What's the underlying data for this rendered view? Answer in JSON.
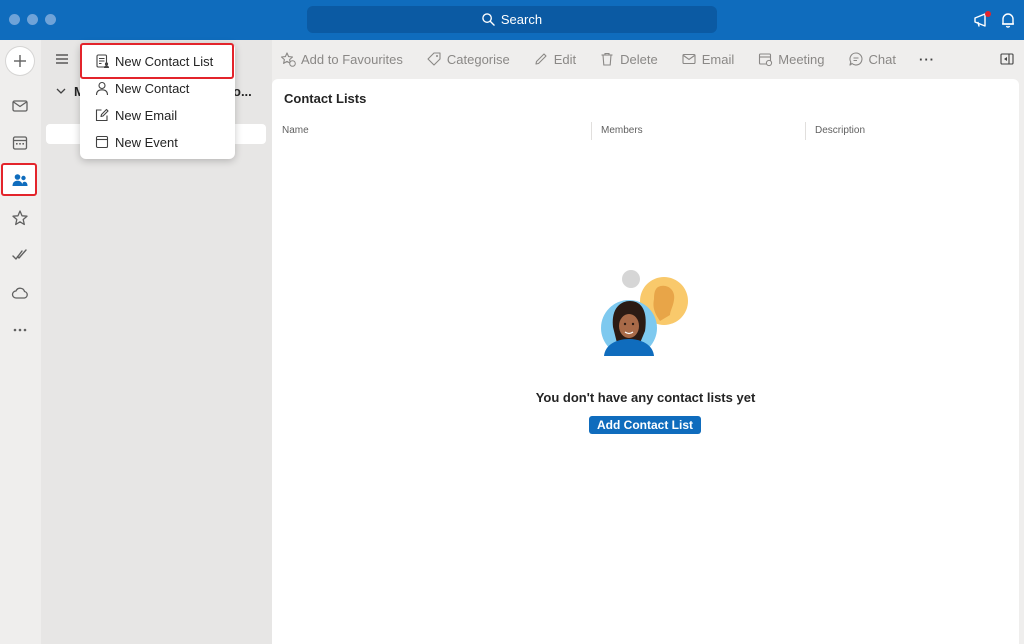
{
  "titlebar": {
    "search_label": "Search",
    "accent_color": "#0f6cbd"
  },
  "rail": {
    "items": [
      {
        "name": "mail-icon"
      },
      {
        "name": "calendar-icon"
      },
      {
        "name": "people-icon",
        "selected": true
      },
      {
        "name": "star-icon"
      },
      {
        "name": "tasks-icon"
      },
      {
        "name": "cloud-icon"
      },
      {
        "name": "more-icon"
      }
    ]
  },
  "folder_pane": {
    "folder_label": "M",
    "folder_more": "o..."
  },
  "new_menu": {
    "items": [
      {
        "label": "New Contact List",
        "icon": "contact-list-icon",
        "highlighted": true
      },
      {
        "label": "New Contact",
        "icon": "person-icon"
      },
      {
        "label": "New Email",
        "icon": "compose-icon"
      },
      {
        "label": "New Event",
        "icon": "calendar-icon"
      }
    ]
  },
  "toolbar": {
    "add_to_favourites": "Add to Favourites",
    "categorise": "Categorise",
    "edit": "Edit",
    "delete": "Delete",
    "email": "Email",
    "meeting": "Meeting",
    "chat": "Chat",
    "more": "···"
  },
  "main": {
    "title": "Contact Lists",
    "columns": [
      "Name",
      "Members",
      "Description"
    ],
    "empty_message": "You don't have any contact lists yet",
    "add_button": "Add Contact List"
  }
}
